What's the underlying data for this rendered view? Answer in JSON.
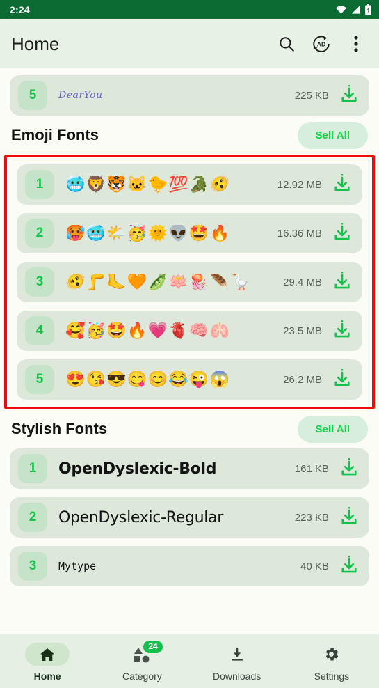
{
  "status_bar": {
    "time": "2:24",
    "icons": [
      "wifi-icon",
      "signal-icon",
      "battery-icon"
    ]
  },
  "app_bar": {
    "title": "Home",
    "actions": [
      {
        "name": "search-icon",
        "label": "Search"
      },
      {
        "name": "remove-ads-icon",
        "label": "AD"
      },
      {
        "name": "overflow-menu-icon",
        "label": "More options"
      }
    ]
  },
  "colors": {
    "status_bar_bg": "#0B6B33",
    "app_bar_bg": "#E8F1E6",
    "page_bg": "#FBFCF5",
    "row_bg": "#DDE7DA",
    "rank_bg": "#C5E3C8",
    "accent_green": "#12D64A",
    "highlight_border": "#F00B0B",
    "nav_bg": "#E6EFE4"
  },
  "partial_row": {
    "rank": "5",
    "name": "DearYou",
    "size": "225 KB",
    "download": "download-icon"
  },
  "sections": [
    {
      "title": "Emoji Fonts",
      "sell_all": "Sell All",
      "highlighted": true,
      "rows": [
        {
          "rank": "1",
          "name": "🥶🦁🐯🐱🐤💯🐊🫨",
          "size": "12.92 MB",
          "download": "download-icon"
        },
        {
          "rank": "2",
          "name": "🥵🥶🌤️🥳🌞👽🤩🔥",
          "size": "16.36 MB",
          "download": "download-icon"
        },
        {
          "rank": "3",
          "name": "🫨🦵🦶🧡🫛🪷🪼🪶🪿",
          "size": "29.4 MB",
          "download": "download-icon"
        },
        {
          "rank": "4",
          "name": "🥰🥳🤩🔥💗🫀🧠🫁",
          "size": "23.5 MB",
          "download": "download-icon"
        },
        {
          "rank": "5",
          "name": "😍😘😎😋😊😂😜😱",
          "size": "26.2 MB",
          "download": "download-icon"
        }
      ]
    },
    {
      "title": "Stylish Fonts",
      "sell_all": "Sell All",
      "highlighted": false,
      "rows": [
        {
          "rank": "1",
          "name": "OpenDyslexic-Bold",
          "size": "161 KB",
          "download": "download-icon",
          "style": "dys-bold"
        },
        {
          "rank": "2",
          "name": "OpenDyslexic-Regular",
          "size": "223 KB",
          "download": "download-icon",
          "style": "dys-reg"
        },
        {
          "rank": "3",
          "name": "Mytype",
          "size": "40 KB",
          "download": "download-icon",
          "style": "mono-name"
        }
      ]
    }
  ],
  "bottom_nav": [
    {
      "label": "Home",
      "icon": "home-icon",
      "active": true,
      "badge": null
    },
    {
      "label": "Category",
      "icon": "category-icon",
      "active": false,
      "badge": "24"
    },
    {
      "label": "Downloads",
      "icon": "download-icon",
      "active": false,
      "badge": null
    },
    {
      "label": "Settings",
      "icon": "gear-icon",
      "active": false,
      "badge": null
    }
  ]
}
